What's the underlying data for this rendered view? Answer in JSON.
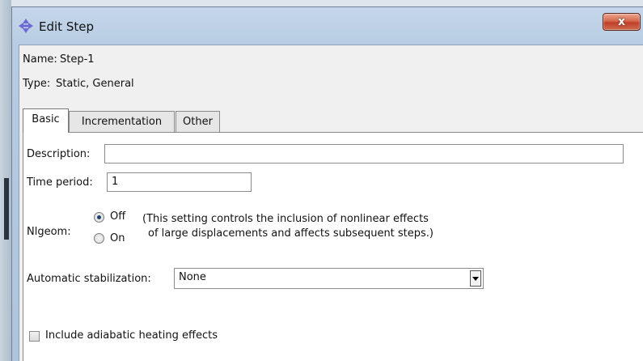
{
  "window": {
    "title": "Edit Step",
    "close_glyph": "x"
  },
  "step": {
    "name_label": "Name:",
    "name_value": "Step-1",
    "type_label": "Type:",
    "type_value": "Static, General"
  },
  "tabs": [
    {
      "label": "Basic",
      "active": true
    },
    {
      "label": "Incrementation",
      "active": false
    },
    {
      "label": "Other",
      "active": false
    }
  ],
  "basic": {
    "description_label": "Description:",
    "description_value": "",
    "time_period_label": "Time period:",
    "time_period_value": "1",
    "nlgeom_label": "Nlgeom:",
    "nlgeom_options": [
      {
        "label": "Off",
        "selected": true
      },
      {
        "label": "On",
        "selected": false
      }
    ],
    "nlgeom_note_line1": "(This setting controls the inclusion of nonlinear effects",
    "nlgeom_note_line2": "of large displacements and affects subsequent steps.)",
    "stabilization_label": "Automatic stabilization:",
    "stabilization_value": "None",
    "adiabatic_label": "Include adiabatic heating effects",
    "adiabatic_checked": false
  },
  "icons": {
    "title": "move-arrows-icon",
    "close": "close-icon",
    "dropdown": "chevron-down-icon"
  },
  "colors": {
    "titlebar": "#b7cce3",
    "close_button": "#c94a30",
    "radio_dot": "#1f3e6c"
  }
}
